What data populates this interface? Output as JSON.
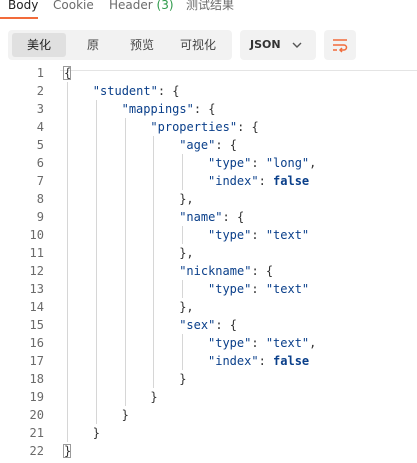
{
  "tabs": [
    {
      "label": "Body",
      "active": true
    },
    {
      "label": "Cookie"
    },
    {
      "label": "Header",
      "count": "(3)"
    },
    {
      "label": "测试结果"
    }
  ],
  "view_modes": [
    "美化",
    "原",
    "预览",
    "可视化"
  ],
  "format": {
    "selected": "JSON"
  },
  "colors": {
    "accent": "#f26b3a",
    "count": "#2e9a4a",
    "key": "#0a3f8a"
  },
  "icons": {
    "format_chevron": "chevron-down-icon",
    "wrap": "wrap-lines-icon"
  },
  "editor": {
    "lines": [
      {
        "n": "1",
        "indent": 0,
        "tokens": [
          {
            "t": "p",
            "v": "{"
          }
        ]
      },
      {
        "n": "2",
        "indent": 1,
        "tokens": [
          {
            "t": "k",
            "v": "\"student\""
          },
          {
            "t": "p",
            "v": ": {"
          }
        ]
      },
      {
        "n": "3",
        "indent": 2,
        "tokens": [
          {
            "t": "k",
            "v": "\"mappings\""
          },
          {
            "t": "p",
            "v": ": {"
          }
        ]
      },
      {
        "n": "4",
        "indent": 3,
        "tokens": [
          {
            "t": "k",
            "v": "\"properties\""
          },
          {
            "t": "p",
            "v": ": {"
          }
        ]
      },
      {
        "n": "5",
        "indent": 4,
        "tokens": [
          {
            "t": "k",
            "v": "\"age\""
          },
          {
            "t": "p",
            "v": ": {"
          }
        ]
      },
      {
        "n": "6",
        "indent": 5,
        "tokens": [
          {
            "t": "k",
            "v": "\"type\""
          },
          {
            "t": "p",
            "v": ": "
          },
          {
            "t": "s",
            "v": "\"long\""
          },
          {
            "t": "p",
            "v": ","
          }
        ]
      },
      {
        "n": "7",
        "indent": 5,
        "tokens": [
          {
            "t": "k",
            "v": "\"index\""
          },
          {
            "t": "p",
            "v": ": "
          },
          {
            "t": "b",
            "v": "false"
          }
        ]
      },
      {
        "n": "8",
        "indent": 4,
        "tokens": [
          {
            "t": "p",
            "v": "},"
          }
        ]
      },
      {
        "n": "9",
        "indent": 4,
        "tokens": [
          {
            "t": "k",
            "v": "\"name\""
          },
          {
            "t": "p",
            "v": ": {"
          }
        ]
      },
      {
        "n": "10",
        "indent": 5,
        "tokens": [
          {
            "t": "k",
            "v": "\"type\""
          },
          {
            "t": "p",
            "v": ": "
          },
          {
            "t": "s",
            "v": "\"text\""
          }
        ]
      },
      {
        "n": "11",
        "indent": 4,
        "tokens": [
          {
            "t": "p",
            "v": "},"
          }
        ]
      },
      {
        "n": "12",
        "indent": 4,
        "tokens": [
          {
            "t": "k",
            "v": "\"nickname\""
          },
          {
            "t": "p",
            "v": ": {"
          }
        ]
      },
      {
        "n": "13",
        "indent": 5,
        "tokens": [
          {
            "t": "k",
            "v": "\"type\""
          },
          {
            "t": "p",
            "v": ": "
          },
          {
            "t": "s",
            "v": "\"text\""
          }
        ]
      },
      {
        "n": "14",
        "indent": 4,
        "tokens": [
          {
            "t": "p",
            "v": "},"
          }
        ]
      },
      {
        "n": "15",
        "indent": 4,
        "tokens": [
          {
            "t": "k",
            "v": "\"sex\""
          },
          {
            "t": "p",
            "v": ": {"
          }
        ]
      },
      {
        "n": "16",
        "indent": 5,
        "tokens": [
          {
            "t": "k",
            "v": "\"type\""
          },
          {
            "t": "p",
            "v": ": "
          },
          {
            "t": "s",
            "v": "\"text\""
          },
          {
            "t": "p",
            "v": ","
          }
        ]
      },
      {
        "n": "17",
        "indent": 5,
        "tokens": [
          {
            "t": "k",
            "v": "\"index\""
          },
          {
            "t": "p",
            "v": ": "
          },
          {
            "t": "b",
            "v": "false"
          }
        ]
      },
      {
        "n": "18",
        "indent": 4,
        "tokens": [
          {
            "t": "p",
            "v": "}"
          }
        ]
      },
      {
        "n": "19",
        "indent": 3,
        "tokens": [
          {
            "t": "p",
            "v": "}"
          }
        ]
      },
      {
        "n": "20",
        "indent": 2,
        "tokens": [
          {
            "t": "p",
            "v": "}"
          }
        ]
      },
      {
        "n": "21",
        "indent": 1,
        "tokens": [
          {
            "t": "p",
            "v": "}"
          }
        ]
      },
      {
        "n": "22",
        "indent": 0,
        "tokens": [
          {
            "t": "p",
            "v": "}"
          }
        ]
      }
    ]
  }
}
